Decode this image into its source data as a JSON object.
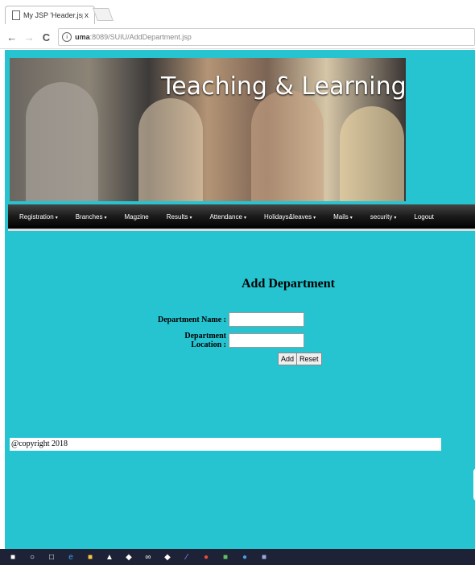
{
  "browser": {
    "tab_title": "My JSP 'Header.jsp' starti",
    "tab_close": "x",
    "url_host": "uma",
    "url_rest": ":8089/SUIU/AddDepartment.jsp"
  },
  "banner": {
    "title": "Teaching & Learning"
  },
  "menu": {
    "items": [
      {
        "label": "Registration",
        "caret": true
      },
      {
        "label": "Branches",
        "caret": true
      },
      {
        "label": "Magzine",
        "caret": false
      },
      {
        "label": "Results",
        "caret": true
      },
      {
        "label": "Attendance",
        "caret": true
      },
      {
        "label": "Holidays&leaves",
        "caret": true
      },
      {
        "label": "Mails",
        "caret": true
      },
      {
        "label": "security",
        "caret": true
      },
      {
        "label": "Logout",
        "caret": false
      }
    ]
  },
  "form": {
    "title": "Add Department",
    "name_label": "Department Name :",
    "name_value": "",
    "location_label": "Department Location :",
    "location_value": "",
    "add_label": "Add",
    "reset_label": "Reset"
  },
  "footer": {
    "text": "@copyright 2018"
  }
}
